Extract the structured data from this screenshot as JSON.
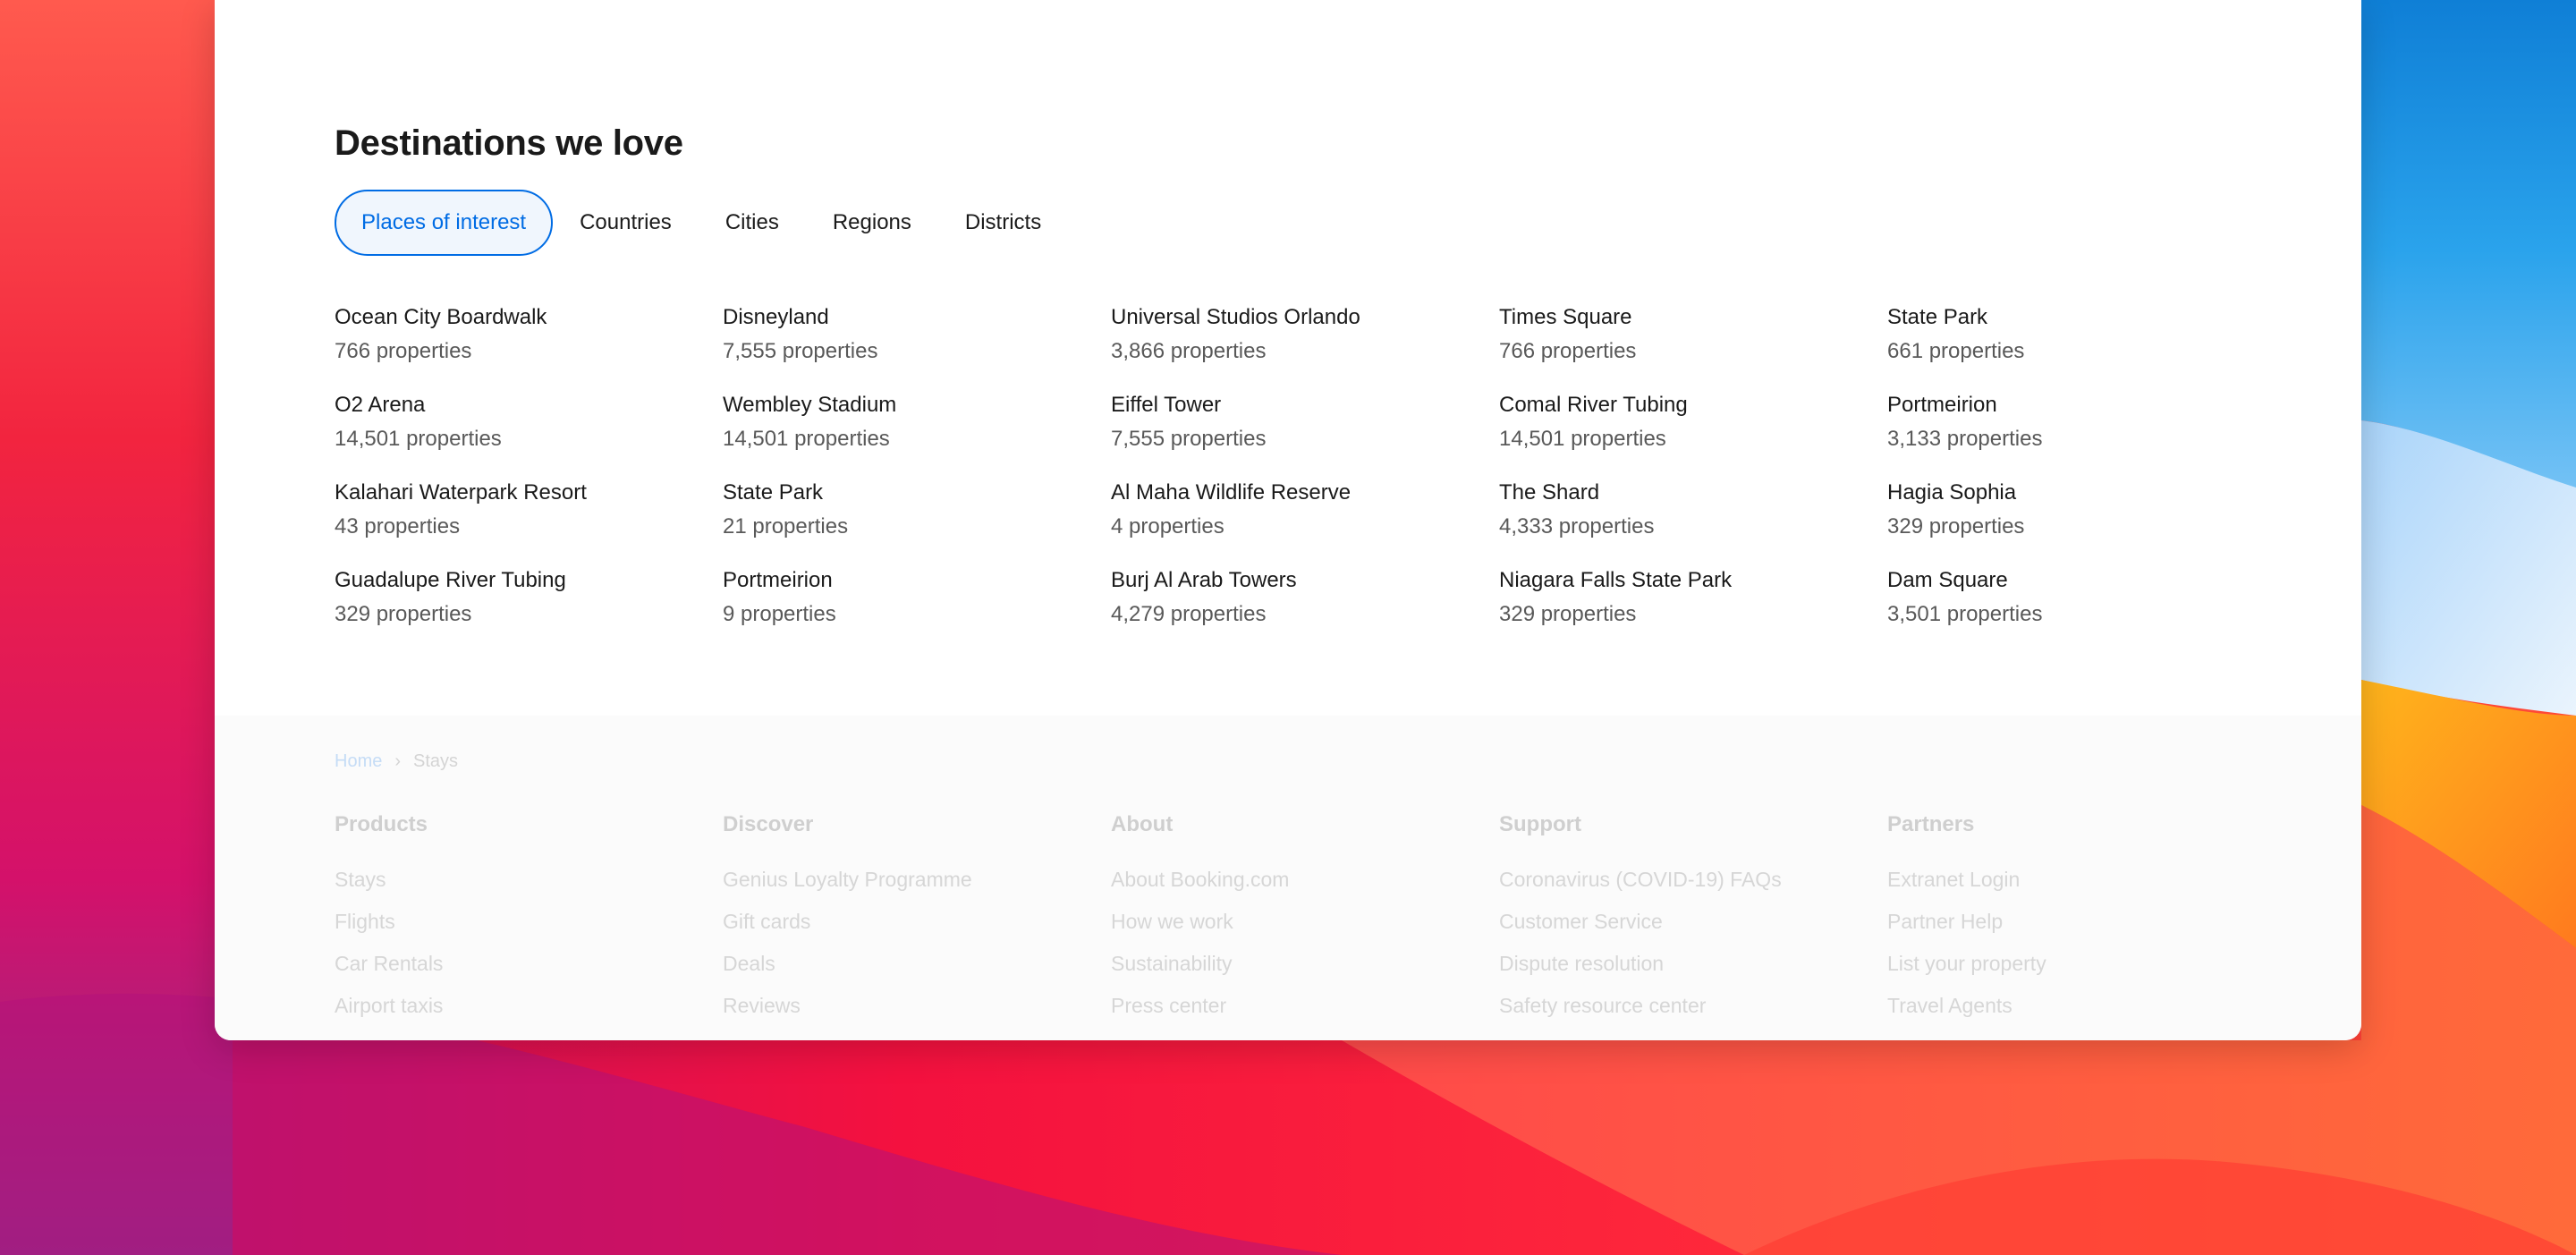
{
  "section": {
    "title": "Destinations we love"
  },
  "tabs": [
    {
      "label": "Places of interest",
      "active": true
    },
    {
      "label": "Countries",
      "active": false
    },
    {
      "label": "Cities",
      "active": false
    },
    {
      "label": "Regions",
      "active": false
    },
    {
      "label": "Districts",
      "active": false
    }
  ],
  "destinations": [
    {
      "name": "Ocean City Boardwalk",
      "count": "766 properties"
    },
    {
      "name": "Disneyland",
      "count": "7,555 properties"
    },
    {
      "name": "Universal Studios Orlando",
      "count": "3,866 properties"
    },
    {
      "name": "Times Square",
      "count": "766 properties"
    },
    {
      "name": "State Park",
      "count": "661 properties"
    },
    {
      "name": "O2 Arena",
      "count": "14,501 properties"
    },
    {
      "name": "Wembley Stadium",
      "count": "14,501 properties"
    },
    {
      "name": "Eiffel Tower",
      "count": "7,555 properties"
    },
    {
      "name": "Comal River Tubing",
      "count": "14,501 properties"
    },
    {
      "name": "Portmeirion",
      "count": "3,133 properties"
    },
    {
      "name": "Kalahari Waterpark Resort",
      "count": "43 properties"
    },
    {
      "name": "State Park",
      "count": "21 properties"
    },
    {
      "name": "Al Maha Wildlife Reserve",
      "count": "4 properties"
    },
    {
      "name": "The Shard",
      "count": "4,333 properties"
    },
    {
      "name": "Hagia Sophia",
      "count": "329 properties"
    },
    {
      "name": "Guadalupe River Tubing",
      "count": "329 properties"
    },
    {
      "name": "Portmeirion",
      "count": "9 properties"
    },
    {
      "name": "Burj Al Arab Towers",
      "count": "4,279 properties"
    },
    {
      "name": "Niagara Falls State Park",
      "count": "329 properties"
    },
    {
      "name": "Dam Square",
      "count": "3,501 properties"
    }
  ],
  "footer": {
    "breadcrumb": {
      "home": "Home",
      "separator": "›",
      "current": "Stays"
    },
    "columns": [
      {
        "title": "Products",
        "links": [
          "Stays",
          "Flights",
          "Car Rentals",
          "Airport taxis"
        ]
      },
      {
        "title": "Discover",
        "links": [
          "Genius Loyalty Programme",
          "Gift cards",
          "Deals",
          "Reviews"
        ]
      },
      {
        "title": "About",
        "links": [
          "About Booking.com",
          "How we work",
          "Sustainability",
          "Press center"
        ]
      },
      {
        "title": "Support",
        "links": [
          "Coronavirus (COVID-19) FAQs",
          "Customer Service",
          "Dispute resolution",
          "Safety resource center"
        ]
      },
      {
        "title": "Partners",
        "links": [
          "Extranet Login",
          "Partner Help",
          "List your property",
          "Travel Agents"
        ]
      }
    ]
  },
  "colors": {
    "accent": "#006ce4",
    "text": "#1a1a1a",
    "muted": "#595959",
    "wallpaper_red": "#f0123e",
    "wallpaper_orange": "#ffa31a",
    "wallpaper_blue": "#1a8de0"
  }
}
